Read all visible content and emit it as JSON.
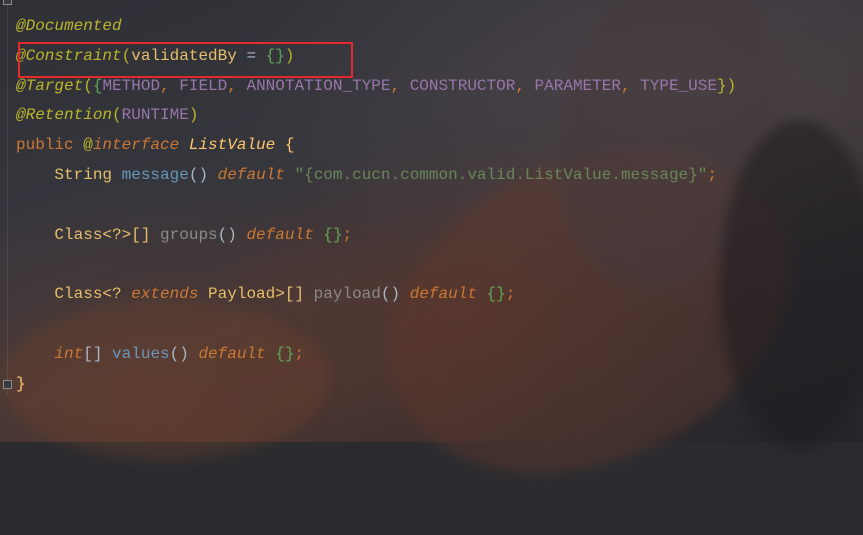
{
  "editor": {
    "lines": [
      {
        "a": "@Documented"
      },
      {
        "a": "@Constraint",
        "b": "(",
        "c": "validatedBy",
        "d": " = ",
        "e": "{}",
        "f": ")"
      },
      {
        "a": "@Target",
        "b": "(",
        "c": "{",
        "d": "METHOD",
        "e": ", ",
        "f": "FIELD",
        "g": ", ",
        "h": "ANNOTATION_TYPE",
        "i": ", ",
        "j": "CONSTRUCTOR",
        "k": ", ",
        "l": "PARAMETER",
        "m": ", ",
        "n": "TYPE_USE",
        "o": "})"
      },
      {
        "a": "@Retention",
        "b": "(",
        "c": "RUNTIME",
        "d": ")"
      },
      {
        "a": "public",
        "b": " @",
        "c": "interface",
        "d": " ",
        "e": "ListValue",
        "f": " {"
      },
      {
        "a": "    String ",
        "b": "message",
        "c": "() ",
        "d": "default",
        "e": " ",
        "f": "\"{com.cucn.common.valid.ListValue.message}\"",
        "g": ";"
      },
      {
        "a": ""
      },
      {
        "a": "    Class<?>[] ",
        "b": "groups",
        "c": "() ",
        "d": "default",
        "e": " ",
        "f": "{}",
        "g": ";"
      },
      {
        "a": ""
      },
      {
        "a": "    Class<? ",
        "b": "extends",
        "c": " ",
        "d": "Payload",
        "e": ">[] ",
        "f": "payload",
        "g": "() ",
        "h": "default",
        "i": " ",
        "j": "{}",
        "k": ";"
      },
      {
        "a": ""
      },
      {
        "a": "    ",
        "b": "int",
        "c": "[] ",
        "d": "values",
        "e": "() ",
        "f": "default",
        "g": " ",
        "h": "{}",
        "i": ";"
      },
      {
        "a": "}"
      }
    ]
  },
  "highlight": {
    "color": "#e3292a",
    "target": "@Constraint(validatedBy = {})"
  },
  "colors": {
    "annotation": "#bbb529",
    "keyword": "#cc7832",
    "string": "#6a8759",
    "enum_constant": "#9876aa",
    "method": "#ffc66d",
    "default_text": "#a9b7c6"
  }
}
